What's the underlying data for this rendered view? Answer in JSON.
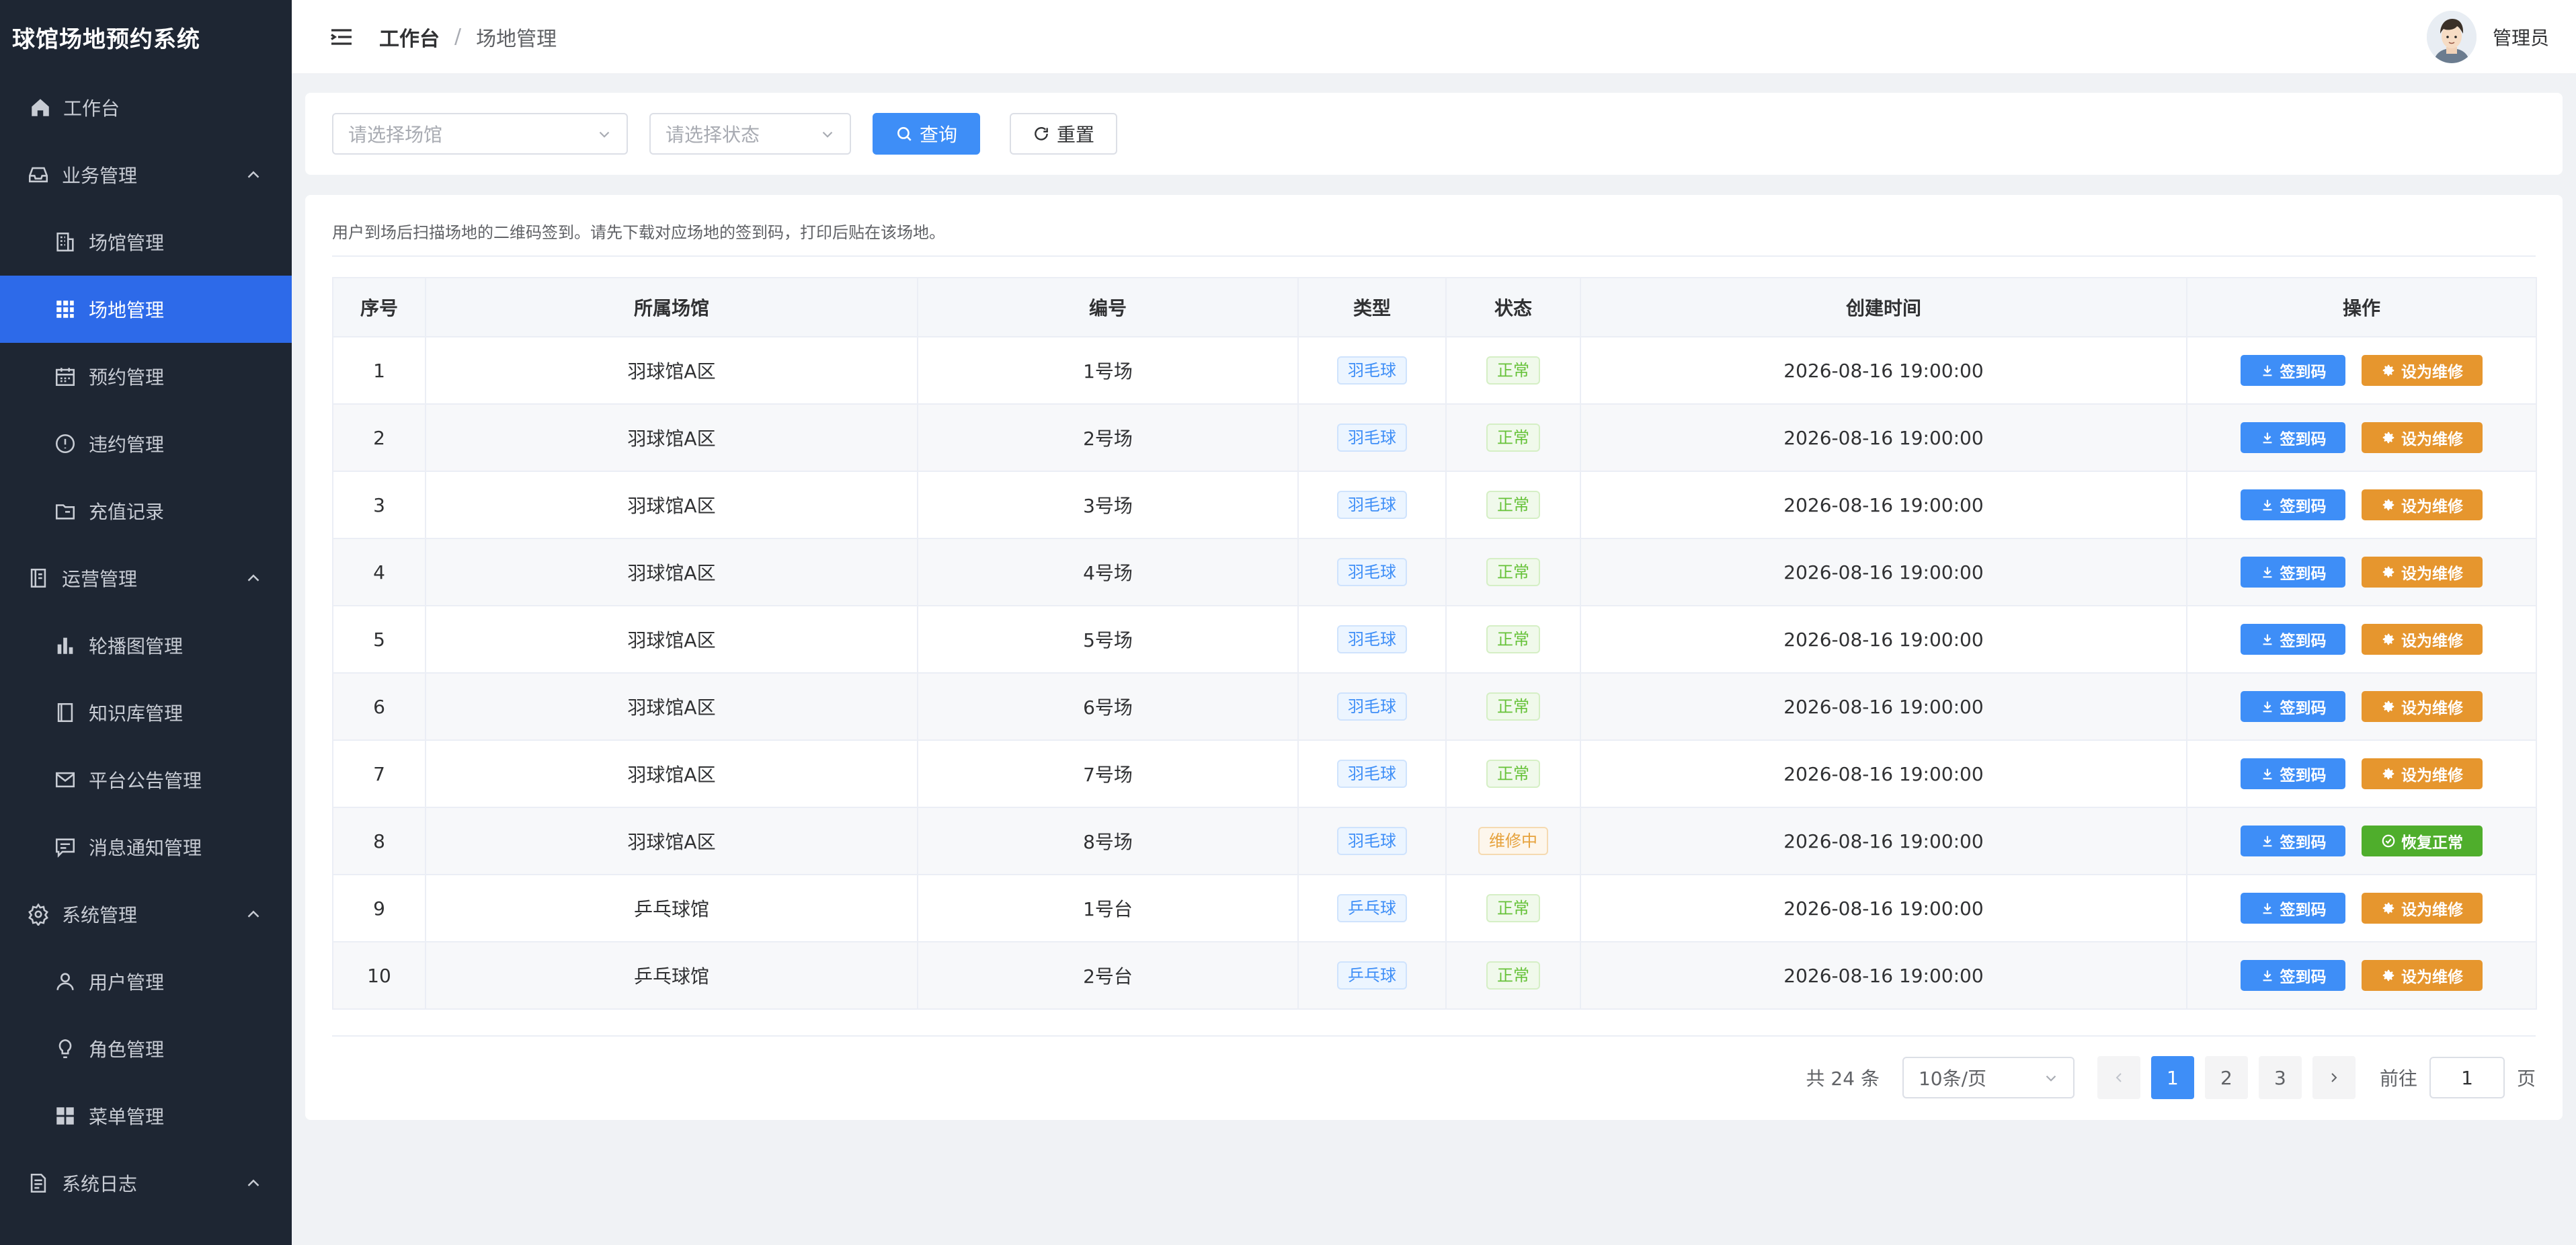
{
  "app": {
    "title": "球馆场地预约系统"
  },
  "sidebar": {
    "workbench": "工作台",
    "groups": [
      {
        "label": "业务管理",
        "icon": "inbox-icon",
        "items": [
          {
            "label": "场馆管理",
            "icon": "building-icon"
          },
          {
            "label": "场地管理",
            "icon": "grid-icon",
            "active": true
          },
          {
            "label": "预约管理",
            "icon": "calendar-icon"
          },
          {
            "label": "违约管理",
            "icon": "warning-icon"
          },
          {
            "label": "充值记录",
            "icon": "folder-icon"
          }
        ]
      },
      {
        "label": "运营管理",
        "icon": "notebook-icon",
        "items": [
          {
            "label": "轮播图管理",
            "icon": "bar-chart-icon"
          },
          {
            "label": "知识库管理",
            "icon": "book-icon"
          },
          {
            "label": "平台公告管理",
            "icon": "mail-icon"
          },
          {
            "label": "消息通知管理",
            "icon": "chat-icon"
          }
        ]
      },
      {
        "label": "系统管理",
        "icon": "gear-icon",
        "items": [
          {
            "label": "用户管理",
            "icon": "user-icon"
          },
          {
            "label": "角色管理",
            "icon": "bulb-icon"
          },
          {
            "label": "菜单管理",
            "icon": "menu-grid-icon"
          }
        ]
      },
      {
        "label": "系统日志",
        "icon": "document-icon",
        "items": []
      }
    ]
  },
  "header": {
    "breadcrumb_home": "工作台",
    "breadcrumb_sep": "/",
    "breadcrumb_current": "场地管理",
    "user_name": "管理员"
  },
  "filters": {
    "venue_placeholder": "请选择场馆",
    "status_placeholder": "请选择状态",
    "query_label": "查询",
    "reset_label": "重置"
  },
  "notice": "用户到场后扫描场地的二维码签到。请先下载对应场地的签到码，打印后贴在该场地。",
  "table": {
    "columns": [
      "序号",
      "所属场馆",
      "编号",
      "类型",
      "状态",
      "创建时间",
      "操作"
    ],
    "rows": [
      {
        "no": "1",
        "venue": "羽球馆A区",
        "code": "1号场",
        "type": "羽毛球",
        "status": "正常",
        "created": "2026-08-16 19:00:00",
        "action1": "签到码",
        "action2": "设为维修"
      },
      {
        "no": "2",
        "venue": "羽球馆A区",
        "code": "2号场",
        "type": "羽毛球",
        "status": "正常",
        "created": "2026-08-16 19:00:00",
        "action1": "签到码",
        "action2": "设为维修"
      },
      {
        "no": "3",
        "venue": "羽球馆A区",
        "code": "3号场",
        "type": "羽毛球",
        "status": "正常",
        "created": "2026-08-16 19:00:00",
        "action1": "签到码",
        "action2": "设为维修"
      },
      {
        "no": "4",
        "venue": "羽球馆A区",
        "code": "4号场",
        "type": "羽毛球",
        "status": "正常",
        "created": "2026-08-16 19:00:00",
        "action1": "签到码",
        "action2": "设为维修"
      },
      {
        "no": "5",
        "venue": "羽球馆A区",
        "code": "5号场",
        "type": "羽毛球",
        "status": "正常",
        "created": "2026-08-16 19:00:00",
        "action1": "签到码",
        "action2": "设为维修"
      },
      {
        "no": "6",
        "venue": "羽球馆A区",
        "code": "6号场",
        "type": "羽毛球",
        "status": "正常",
        "created": "2026-08-16 19:00:00",
        "action1": "签到码",
        "action2": "设为维修"
      },
      {
        "no": "7",
        "venue": "羽球馆A区",
        "code": "7号场",
        "type": "羽毛球",
        "status": "正常",
        "created": "2026-08-16 19:00:00",
        "action1": "签到码",
        "action2": "设为维修"
      },
      {
        "no": "8",
        "venue": "羽球馆A区",
        "code": "8号场",
        "type": "羽毛球",
        "status": "维修中",
        "created": "2026-08-16 19:00:00",
        "action1": "签到码",
        "action2": "恢复正常"
      },
      {
        "no": "9",
        "venue": "乒乓球馆",
        "code": "1号台",
        "type": "乒乓球",
        "status": "正常",
        "created": "2026-08-16 19:00:00",
        "action1": "签到码",
        "action2": "设为维修"
      },
      {
        "no": "10",
        "venue": "乒乓球馆",
        "code": "2号台",
        "type": "乒乓球",
        "status": "正常",
        "created": "2026-08-16 19:00:00",
        "action1": "签到码",
        "action2": "设为维修"
      }
    ]
  },
  "pagination": {
    "total_text": "共 24 条",
    "page_size": "10条/页",
    "pages": [
      "1",
      "2",
      "3"
    ],
    "current_page": "1",
    "goto_label": "前往",
    "goto_value": "1",
    "goto_suffix": "页"
  },
  "colors": {
    "sidebar_bg": "#1e2633",
    "active_item": "#2d6ae9",
    "primary": "#3e8ef7",
    "warning_button": "#e6962e",
    "success_button": "#4fae2c"
  }
}
